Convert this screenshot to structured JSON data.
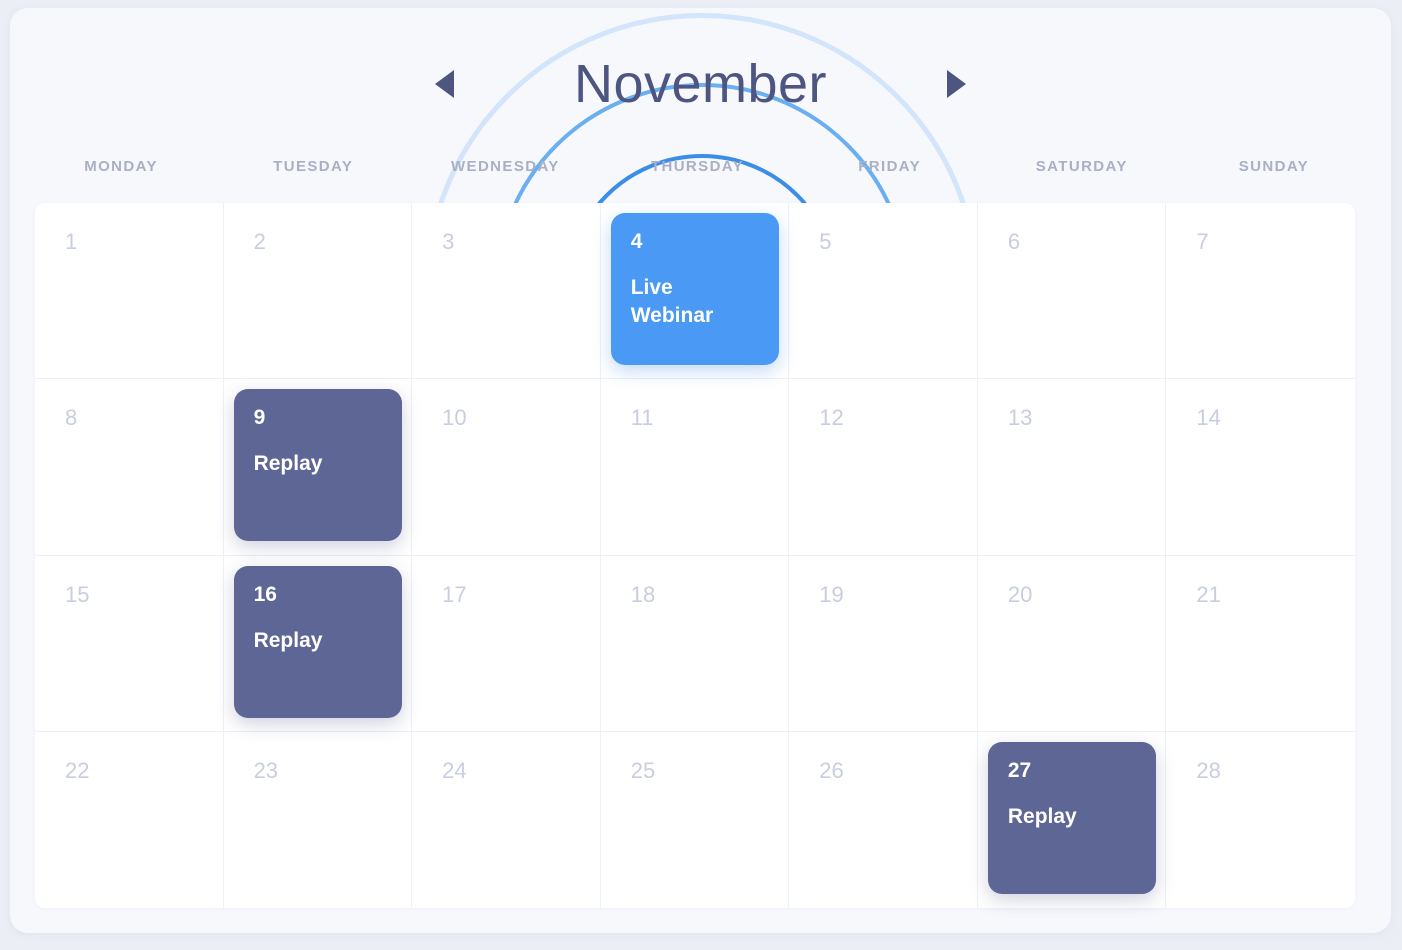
{
  "header": {
    "month": "November",
    "prev_label": "◀",
    "next_label": "▶"
  },
  "weekdays": [
    "MONDAY",
    "TUESDAY",
    "WEDNESDAY",
    "THURSDAY",
    "FRIDAY",
    "SATURDAY",
    "SUNDAY"
  ],
  "colors": {
    "live": "#4a9af5",
    "replay": "#5e6695",
    "ring_inner": "#3b8ee8",
    "ring_middle": "#6aafef",
    "ring_outer": "#d2e5fb",
    "day_number": "#c9cde0",
    "weekday_label": "#aab0c4",
    "month_title": "#4e5580",
    "panel_bg": "#f6f8fc",
    "grid_bg": "#ffffff"
  },
  "days": [
    {
      "num": "1",
      "event": null
    },
    {
      "num": "2",
      "event": null
    },
    {
      "num": "3",
      "event": null
    },
    {
      "num": "4",
      "event": {
        "type": "live",
        "label": "Live Webinar",
        "highlighted": true
      }
    },
    {
      "num": "5",
      "event": null
    },
    {
      "num": "6",
      "event": null
    },
    {
      "num": "7",
      "event": null
    },
    {
      "num": "8",
      "event": null
    },
    {
      "num": "9",
      "event": {
        "type": "replay",
        "label": "Replay",
        "highlighted": false
      }
    },
    {
      "num": "10",
      "event": null
    },
    {
      "num": "11",
      "event": null
    },
    {
      "num": "12",
      "event": null
    },
    {
      "num": "13",
      "event": null
    },
    {
      "num": "14",
      "event": null
    },
    {
      "num": "15",
      "event": null
    },
    {
      "num": "16",
      "event": {
        "type": "replay",
        "label": "Replay",
        "highlighted": false
      }
    },
    {
      "num": "17",
      "event": null
    },
    {
      "num": "18",
      "event": null
    },
    {
      "num": "19",
      "event": null
    },
    {
      "num": "20",
      "event": null
    },
    {
      "num": "21",
      "event": null
    },
    {
      "num": "22",
      "event": null
    },
    {
      "num": "23",
      "event": null
    },
    {
      "num": "24",
      "event": null
    },
    {
      "num": "25",
      "event": null
    },
    {
      "num": "26",
      "event": null
    },
    {
      "num": "27",
      "event": {
        "type": "replay",
        "label": "Replay",
        "highlighted": false
      }
    },
    {
      "num": "28",
      "event": null
    }
  ]
}
